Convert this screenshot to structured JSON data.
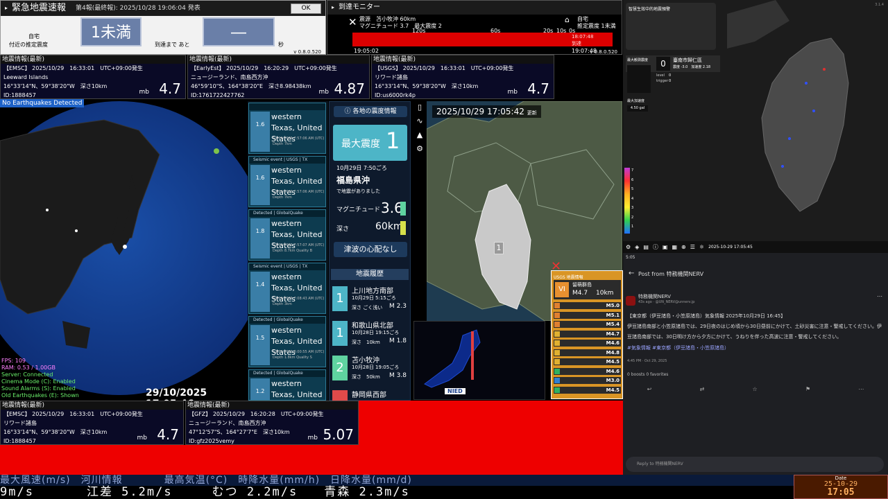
{
  "eew": {
    "title": "緊急地震速報",
    "subtitle": "第4報(最終報): 2025/10/28 19:06:04 発表",
    "ok": "OK",
    "home_label": "自宅",
    "area_label": "付近の推定震度",
    "intensity": "1未満",
    "arrival_label": "到達まで あと",
    "arrival_value": "―",
    "sec": "秒",
    "version": "v 0.8.0.520"
  },
  "arrival": {
    "title": "到達モニター",
    "epicenter": "震源　苫小牧沖 60km",
    "magnitude": "マグニチュード 3.7　最大震度 2",
    "home": "自宅",
    "home_int": "推定震度 1未満",
    "ticks": [
      "120s",
      "60s",
      "20s",
      "10s",
      "0s"
    ],
    "time_start": "19:05:02",
    "time_end": "19:07:48",
    "arrival_time": "18:07:48",
    "arrived": "到達",
    "version": "v 0.8.0.520"
  },
  "info_top": [
    {
      "hd": "地震情報(最新)",
      "l1": "【EMSC】 2025/10/29　16:33:01　UTC+09:00発生",
      "l2": "Leeward Islands",
      "l3": "16°33'14\"N、59°38'20\"W　深さ10km",
      "l4": "ID:1888457",
      "mb": "mb",
      "mag": "4.7"
    },
    {
      "hd": "地震情報(最新)",
      "l1": "【EarlyEst】 2025/10/29　16:20:29　UTC+09:00発生",
      "l2": "ニュージーランド、南島西方沖",
      "l3": "46°59'10\"S、164°38'20\"E　深さ8.98438km",
      "l4": "ID:1761722427762",
      "mb": "mb",
      "mag": "4.87"
    },
    {
      "hd": "地震情報(最新)",
      "l1": "【USGS】 2025/10/29　16:33:01　UTC+09:00発生",
      "l2": "リワード諸島",
      "l3": "16°33'14\"N、59°38'20\"W　深さ10km",
      "l4": "ID:us6000rk4p",
      "mb": "mb",
      "mag": "4.7"
    }
  ],
  "info_bottom": [
    {
      "hd": "地震情報(最新)",
      "l1": "【EMSC】 2025/10/29　16:33:01　UTC+09:00発生",
      "l2": "リワード諸島",
      "l3": "16°33'14\"N、59°38'20\"W　深さ10km",
      "l4": "ID:1888457",
      "mb": "mb",
      "mag": "4.7"
    },
    {
      "hd": "地震情報(最新)",
      "l1": "【GFZ】 2025/10/29　16:20:28　UTC+09:00発生",
      "l2": "ニュージーランド、南島西方沖",
      "l3": "47°12'57\"S、164°27'7\"E　深さ10km",
      "l4": "ID:gfz2025vemy",
      "mb": "mb",
      "mag": "5.07"
    }
  ],
  "globe": {
    "banner": "No Earthquakes Detected",
    "timestamp": "29/10/2025 17:05:46",
    "stats": [
      "FPS: 109",
      "RAM: 0.53 / 1.00GB",
      "Server: Connected",
      "Cinema Mode (C): Enabled",
      "Sound Alarms (S): Enabled",
      "Old Earthquakes (E): Shown"
    ]
  },
  "quakes": [
    {
      "hd": "",
      "mag": "1.6",
      "place": "western Texas, United States",
      "date": "10/29/2025 7:57:06 AM (UTC)",
      "depth": "Depth 7km"
    },
    {
      "hd": "Seismic event | USGS | TX",
      "mag": "1.6",
      "place": "western Texas, United States",
      "date": "10/29/2025 7:57:06 AM (UTC)",
      "depth": "Depth 7km"
    },
    {
      "hd": "Detected | GlobalQuake",
      "mag": "1.8",
      "place": "western Texas, United States",
      "date": "10/29/2025 7:57:07 AM (UTC)",
      "depth": "Depth 8.7km   Quality B"
    },
    {
      "hd": "Seismic event | USGS | TX",
      "mag": "1.4",
      "place": "western Texas, United States",
      "date": "10/29/2025 7:08:43 AM (UTC)",
      "depth": "Depth 3km"
    },
    {
      "hd": "Detected | GlobalQuake",
      "mag": "1.5",
      "place": "western Texas, United States",
      "date": "10/29/2025 8:00:55 AM (UTC)",
      "depth": "Depth 1.8km   Quality S"
    },
    {
      "hd": "Detected | GlobalQuake",
      "mag": "1.2",
      "place": "western Texas, United States",
      "date": "",
      "depth": ""
    }
  ],
  "jma": {
    "header": "各地の震度情報",
    "max_label": "最大震度",
    "max_value": "1",
    "datetime": "10月29日 7:50ごろ",
    "place": "福島県沖",
    "note": "で地震がありました",
    "mag_label": "マグニチュード",
    "mag_value": "3.6",
    "depth_label": "深さ",
    "depth_value": "60km",
    "tsunami": "津波の心配なし",
    "history_header": "地震履歴",
    "history": [
      {
        "int": "1",
        "place": "上川地方南部",
        "time": "10月29日 5:15ごろ",
        "depth": "深さ ごく浅い",
        "m": "M 2.3"
      },
      {
        "int": "1",
        "place": "和歌山県北部",
        "time": "10月28日 19:15ごろ",
        "depth": "深さ　10km",
        "m": "M 1.8"
      },
      {
        "int": "2",
        "place": "苫小牧沖",
        "time": "10月28日 19:05ごろ",
        "depth": "深さ　50km",
        "m": "M 3.8"
      },
      {
        "int": "",
        "place": "静岡県西部",
        "time": "",
        "depth": "",
        "m": ""
      }
    ],
    "map_time": "2025/10/29  17:05:42",
    "map_update": "更新",
    "map_marker": "1",
    "nied": "NIED"
  },
  "usgs": {
    "header": "USGS 地震情報",
    "int": "VI",
    "place": "留萌群島",
    "mag": "M4.7",
    "depth": "10km",
    "rows": [
      "M5.0",
      "M5.1",
      "M5.4",
      "M4.7",
      "M4.6",
      "M4.8",
      "M4.5",
      "M4.6",
      "M3.0",
      "M4.5"
    ],
    "colors": [
      "#e08030",
      "#e08030",
      "#e08030",
      "#e0b030",
      "#e0b030",
      "#e0b030",
      "#e0b030",
      "#30b060",
      "#3080d0",
      "#30b060"
    ]
  },
  "taiwan": {
    "title": "智慧生效中的地震預警",
    "max_int_label": "最大観測震度",
    "station_val": "0",
    "station_name": "臺南市歸仁區",
    "station_sub": "震度 -3.0　加速度 2.18",
    "level_label": "level",
    "level_value": "0",
    "trigger_label": "trigger",
    "trigger_value": "0",
    "max_acc_label": "最大加速度",
    "max_acc_value": "4.50 gal",
    "scale": [
      "7",
      "6",
      "5",
      "4",
      "3",
      "2",
      "1"
    ],
    "timestamp": "2025-10-29 17:05:45",
    "version": "3.1.4"
  },
  "post": {
    "status_time": "5:05",
    "title": "Post from 特務機関NERV",
    "author": "特務機関NERV",
    "handle": "43s ago · @UN_NERV@unnerv.jp",
    "body": "【東京都（伊豆諸島・小笠原諸島）気象情報 2025年10月29日 16:45】\n伊豆諸島南部と小笠原諸島では、29日夜のはじめ頃から30日昼前にかけて、土砂災害に注意・警戒してください。伊豆諸島南部では、30日明け方から夕方にかけて、うねりを伴った高波に注意・警戒してください。",
    "tags": "#気象情報 #東京都（伊豆諸島・小笠原諸島）",
    "time": "4:45 PM · Oct 29, 2025",
    "stats": "0 boosts  0 favorites",
    "reply": "Reply to 特務機関NERV"
  },
  "ticker": {
    "row1": "最大風速(m/s)　河川情報　　　　最高気温(°C)　時降水量(mm/h)　日降水量(mm/d)",
    "row2": "9m/s　　　　江差 5.2m/s　　　むつ 2.2m/s　　青森 2.3m/s"
  },
  "clock": {
    "label": "Date",
    "date": "25-10-29",
    "time": "17:05"
  }
}
